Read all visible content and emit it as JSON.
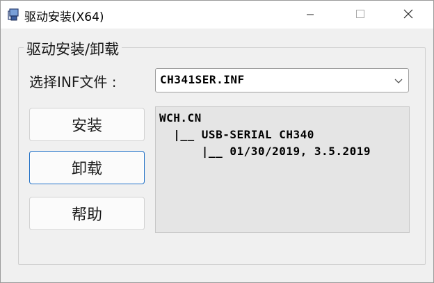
{
  "window": {
    "title": "驱动安装(X64)",
    "controls": {
      "minimize_icon": "minimize-icon",
      "maximize_icon": "maximize-icon",
      "close_icon": "close-icon"
    }
  },
  "group": {
    "title": "驱动安装/卸载",
    "inf_label": "选择INF文件 :",
    "inf_selected": "CH341SER.INF"
  },
  "buttons": {
    "install": "安装",
    "uninstall": "卸载",
    "help": "帮助"
  },
  "info": {
    "lines": [
      "WCH.CN",
      "  |__ USB-SERIAL CH340",
      "      |__ 01/30/2019, 3.5.2019"
    ]
  },
  "colors": {
    "focus_border": "#1f6fc5",
    "window_bg": "#f0f0f0",
    "info_bg": "#e5e5e5"
  }
}
